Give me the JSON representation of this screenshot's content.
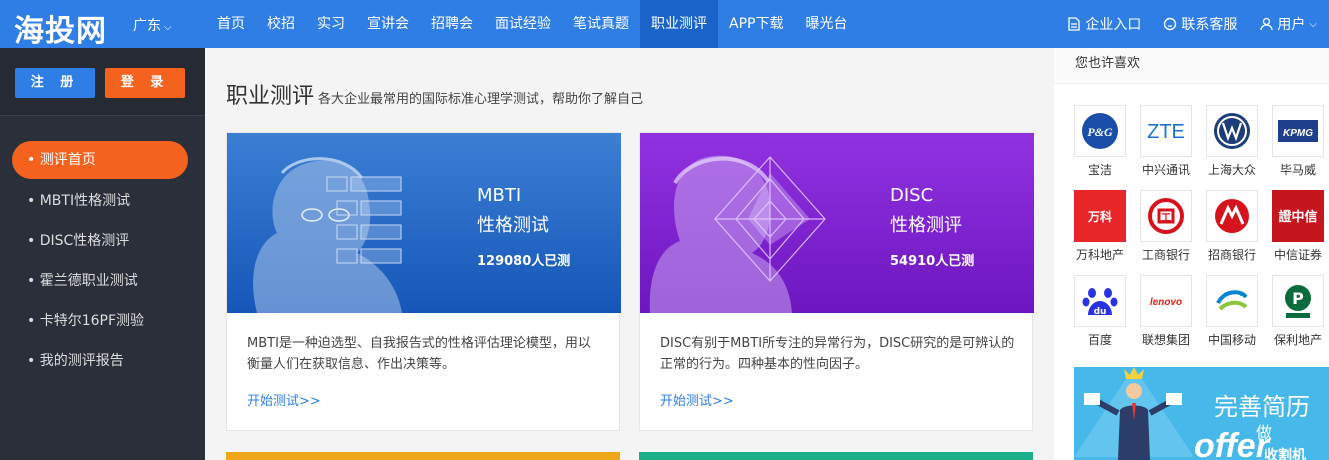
{
  "header": {
    "logo": "海投网",
    "city": "广东",
    "nav": [
      "首页",
      "校招",
      "实习",
      "宣讲会",
      "招聘会",
      "面试经验",
      "笔试真题",
      "职业测评",
      "APP下载",
      "曝光台"
    ],
    "active_nav": "职业测评",
    "right": {
      "enterprise": "企业入口",
      "service": "联系客服",
      "user": "用户"
    },
    "colors": {
      "bar": "#2f7ee5",
      "active": "#1a63c9"
    }
  },
  "sidebar": {
    "register": "注 册",
    "login": "登 录",
    "items": [
      "• 测评首页",
      "• MBTI性格测试",
      "• DISC性格测评",
      "• 霍兰德职业测试",
      "• 卡特尔16PF测验",
      "• 我的测评报告"
    ]
  },
  "main": {
    "title": "职业测评",
    "subtitle": "各大企业最常用的国际标准心理学测试，帮助你了解自己",
    "cards": [
      {
        "title_line1": "MBTI",
        "title_line2": "性格测试",
        "count": "129080人已测",
        "desc": "MBTI是一种迫选型、自我报告式的性格评估理论模型，用以衡量人们在获取信息、作出决策等。",
        "link": "开始测试>>"
      },
      {
        "title_line1": "DISC",
        "title_line2": "性格测评",
        "count": "54910人已测",
        "desc": "DISC有别于MBTI所专注的异常行为，DISC研究的是可辨认的正常的行为。四种基本的性向因子。",
        "link": "开始测试>>"
      }
    ]
  },
  "rightbar": {
    "title": "您也许喜欢",
    "companies": [
      {
        "name": "宝洁",
        "logo": "P&G"
      },
      {
        "name": "中兴通讯",
        "logo": "ZTE"
      },
      {
        "name": "上海大众",
        "logo": "VW"
      },
      {
        "name": "毕马威",
        "logo": "KPMG"
      },
      {
        "name": "万科地产",
        "logo": "万科"
      },
      {
        "name": "工商银行",
        "logo": "工"
      },
      {
        "name": "招商银行",
        "logo": "M"
      },
      {
        "name": "中信证券",
        "logo": "證中信"
      },
      {
        "name": "百度",
        "logo": "du"
      },
      {
        "name": "联想集团",
        "logo": "lenovo"
      },
      {
        "name": "中国移动",
        "logo": "移动"
      },
      {
        "name": "保利地产",
        "logo": "P"
      }
    ],
    "ad": {
      "line1": "完善简历",
      "line2": "做",
      "line3": "offer",
      "line4": "收割机"
    }
  }
}
